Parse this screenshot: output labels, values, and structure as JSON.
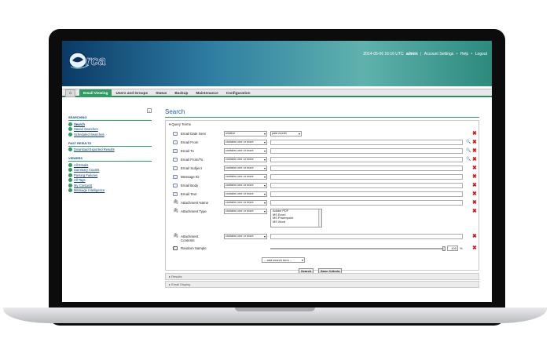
{
  "header": {
    "logo_text": "rca",
    "timestamp": "2014-05-06 16:16 UTC",
    "user": "admin",
    "links": [
      "Account Settings",
      "Help",
      "Logout"
    ]
  },
  "nav": {
    "tabs": [
      "Email Viewing",
      "Users and Groups",
      "Status",
      "Backup",
      "Maintenance",
      "Configuration"
    ]
  },
  "sidebar": {
    "sections": [
      {
        "title": "SEARCHING",
        "items": [
          "Search",
          "Saved Searches",
          "Scheduled Searches"
        ]
      },
      {
        "title": "PAST RESULTS",
        "items": [
          "Download Exported Results"
        ]
      },
      {
        "title": "VIEWERS",
        "items": [
          "All Emails",
          "Summary Counts",
          "Parsing Failures",
          "All Tags",
          "My Contacts",
          "Message Intelligence"
        ]
      }
    ]
  },
  "main": {
    "title": "Search",
    "panel_title": "Query Terms",
    "rows": [
      {
        "label": "Email Date Sent",
        "select": "relative",
        "select2": "past month"
      },
      {
        "label": "Email From",
        "select": "contains one or more"
      },
      {
        "label": "Email To",
        "select": "contains one or more"
      },
      {
        "label": "Email From/To",
        "select": "contains one or more"
      },
      {
        "label": "Email Subject",
        "select": "contains one or more"
      },
      {
        "label": "Message ID",
        "select": "contains one or more"
      },
      {
        "label": "Email Body",
        "select": "contains one or more"
      },
      {
        "label": "Email Text",
        "select": "contains one or more"
      },
      {
        "label": "Attachment Name",
        "select": "contains one or more"
      },
      {
        "label": "Attachment Type",
        "select": "contains one or more"
      },
      {
        "label": "Attachment Contents",
        "select": "contains one or more"
      },
      {
        "label": "Random Sample"
      }
    ],
    "attachment_types": [
      "Adobe PDF",
      "MS Excel",
      "MS Powerpoint",
      "MS Word"
    ],
    "sample_value": "100",
    "sample_unit": "%",
    "add_term": "-- add search term --",
    "search_button": "Search",
    "save_button": "Save Criteria",
    "results_label": "Results",
    "email_display_label": "Email Display"
  }
}
